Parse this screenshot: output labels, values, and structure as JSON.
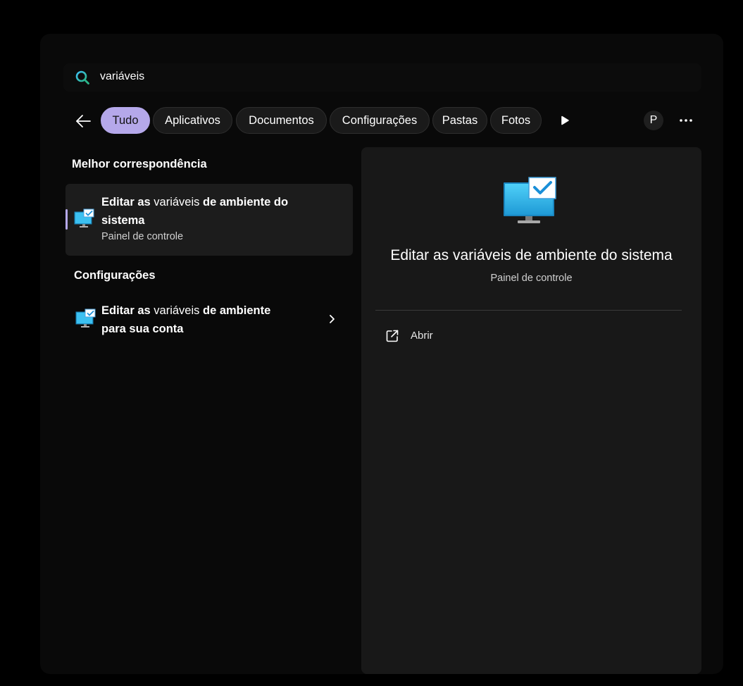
{
  "search": {
    "query": "variáveis"
  },
  "filters": {
    "back_icon": "back-arrow-icon",
    "tabs": [
      {
        "label": "Tudo",
        "active": true
      },
      {
        "label": "Aplicativos",
        "active": false
      },
      {
        "label": "Documentos",
        "active": false
      },
      {
        "label": "Configurações",
        "active": false
      },
      {
        "label": "Pastas",
        "active": false
      },
      {
        "label": "Fotos",
        "active": false
      }
    ],
    "more_tabs_icon": "play-icon",
    "avatar_letter": "P",
    "more_icon": "ellipsis-icon"
  },
  "best_match": {
    "heading": "Melhor correspondência",
    "item": {
      "title_part1": "Editar as",
      "title_match": "variáveis",
      "title_part2": "de ambiente do",
      "title_line2": "sistema",
      "subtitle": "Painel de controle",
      "icon": "monitor-check-icon"
    }
  },
  "settings_section": {
    "heading": "Configurações",
    "item": {
      "title_part1": "Editar as",
      "title_match": "variáveis",
      "title_part2": "de ambiente",
      "title_line2": "para sua conta",
      "icon": "monitor-check-icon"
    }
  },
  "detail": {
    "title": "Editar as variáveis de ambiente do sistema",
    "subtitle": "Painel de controle",
    "actions": [
      {
        "label": "Abrir",
        "icon": "open-external-icon"
      }
    ]
  },
  "colors": {
    "accent": "#b5a8ea",
    "panel": "#090909",
    "detail_bg": "#181818"
  }
}
